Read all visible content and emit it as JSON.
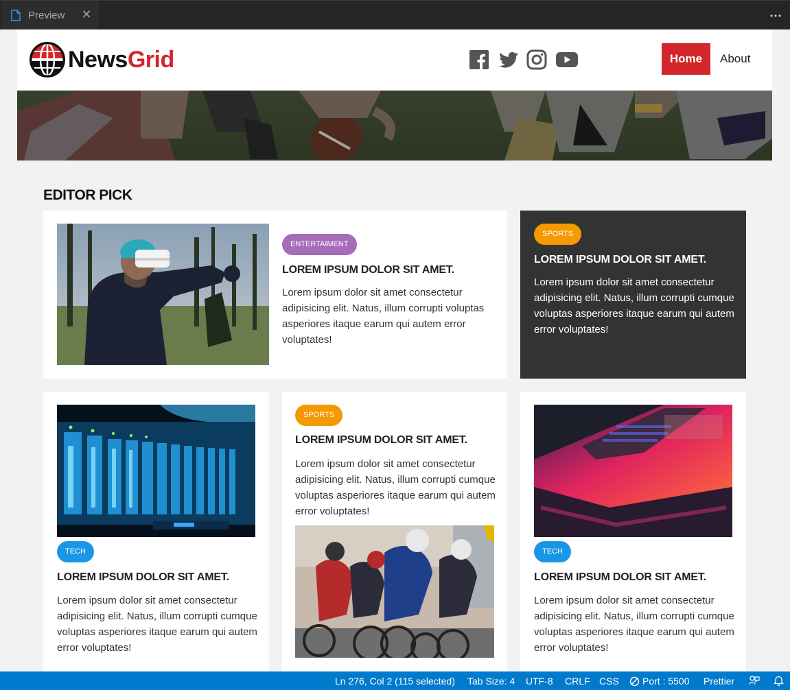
{
  "editor": {
    "tab_label": "Preview"
  },
  "site": {
    "logo": {
      "part1": "News",
      "part2": "Grid"
    },
    "nav": {
      "home": "Home",
      "about": "About"
    },
    "social": [
      "facebook-icon",
      "twitter-icon",
      "instagram-icon",
      "youtube-icon"
    ],
    "colors": {
      "brand_red": "#d3262a",
      "entertainment": "#a66bb9",
      "sports": "#f59900",
      "tech": "#1997e6",
      "dark_card": "#333333"
    }
  },
  "section": {
    "title": "EDITOR PICK"
  },
  "cards": {
    "featured": {
      "category": "ENTERTAIMENT",
      "title": "LOREM IPSUM DOLOR SIT AMET.",
      "text": "Lorem ipsum dolor sit amet consectetur adipisicing elit. Natus, illum corrupti voluptas asperiores itaque earum qui autem error voluptates!"
    },
    "side": {
      "category": "SPORTS",
      "title": "LOREM IPSUM DOLOR SIT AMET.",
      "text": "Lorem ipsum dolor sit amet consectetur adipisicing elit. Natus, illum corrupti cumque voluptas asperiores itaque earum qui autem error voluptates!"
    },
    "tech1": {
      "category": "TECH",
      "title": "LOREM IPSUM DOLOR SIT AMET.",
      "text": "Lorem ipsum dolor sit amet consectetur adipisicing elit. Natus, illum corrupti cumque voluptas asperiores itaque earum qui autem error voluptates!"
    },
    "sports2": {
      "category": "SPORTS",
      "title": "LOREM IPSUM DOLOR SIT AMET.",
      "text": "Lorem ipsum dolor sit amet consectetur adipisicing elit. Natus, illum corrupti cumque voluptas asperiores itaque earum qui autem error voluptates!"
    },
    "tech2": {
      "category": "TECH",
      "title": "LOREM IPSUM DOLOR SIT AMET.",
      "text": "Lorem ipsum dolor sit amet consectetur adipisicing elit. Natus, illum corrupti cumque voluptas asperiores itaque earum qui autem error voluptates!"
    }
  },
  "statusbar": {
    "position": "Ln 276, Col 2 (115 selected)",
    "tab_size": "Tab Size: 4",
    "encoding": "UTF-8",
    "eol": "CRLF",
    "language": "CSS",
    "port": "Port : 5500",
    "formatter": "Prettier"
  }
}
